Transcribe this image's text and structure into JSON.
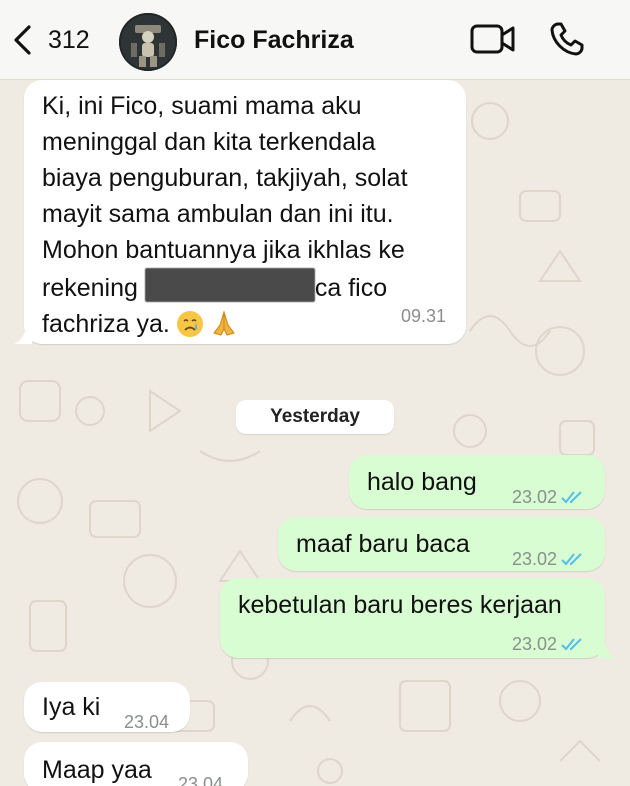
{
  "header": {
    "back_count": "312",
    "contact_name": "Fico Fachriza",
    "icons": {
      "back": "chevron-left-icon",
      "video": "video-call-icon",
      "phone": "phone-icon"
    }
  },
  "messages": [
    {
      "direction": "incoming",
      "text_line1": "Ki, ini Fico, suami mama aku",
      "text_line2": "meninggal dan kita terkendala",
      "text_line3": "biaya penguburan, takjiyah, solat",
      "text_line4": "mayit sama ambulan dan ini itu.",
      "text_line5": "Mohon bantuannya jika ikhlas ke",
      "text_line6a": "rekening",
      "text_line6b": "ca fico",
      "text_line7": "fachriza ya.",
      "time": "09.31"
    }
  ],
  "date_separator": "Yesterday",
  "outgoing": [
    {
      "text": "halo bang",
      "time": "23.02"
    },
    {
      "text": "maaf baru baca",
      "time": "23.02"
    },
    {
      "text": "kebetulan baru beres kerjaan",
      "time": "23.02"
    }
  ],
  "incoming_after": [
    {
      "text": "Iya ki",
      "time": "23.04"
    },
    {
      "text": "Maap yaa",
      "time": "23.04"
    }
  ],
  "colors": {
    "header_bg": "#f7f7f5",
    "chat_bg": "#efeae2",
    "incoming_bubble": "#ffffff",
    "outgoing_bubble": "#d9fdd3",
    "read_ticks": "#53bdeb"
  }
}
